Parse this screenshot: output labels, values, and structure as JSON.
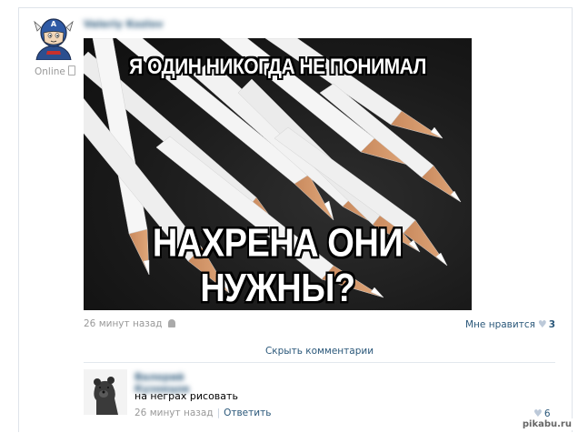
{
  "post": {
    "author_name": "Valeriy Kozlov",
    "status": "Online",
    "meme_top_text": "Я ОДИН НИКОГДА НЕ ПОНИМАЛ",
    "meme_bottom_text": "НАХРЕНА ОНИ НУЖНЫ?",
    "time": "26 минут назад",
    "like_label": "Мне нравится",
    "like_count": "3",
    "hide_comments_label": "Скрыть комментарии"
  },
  "comment": {
    "author_name": "Валерий Кузнецов",
    "text": "на неграх рисовать",
    "time": "26 минут назад",
    "reply_label": "Ответить",
    "like_count": "6"
  },
  "watermark": "pikabu.ru",
  "colors": {
    "link": "#2b587a",
    "muted": "#999999",
    "heart": "#bcc9d9"
  }
}
